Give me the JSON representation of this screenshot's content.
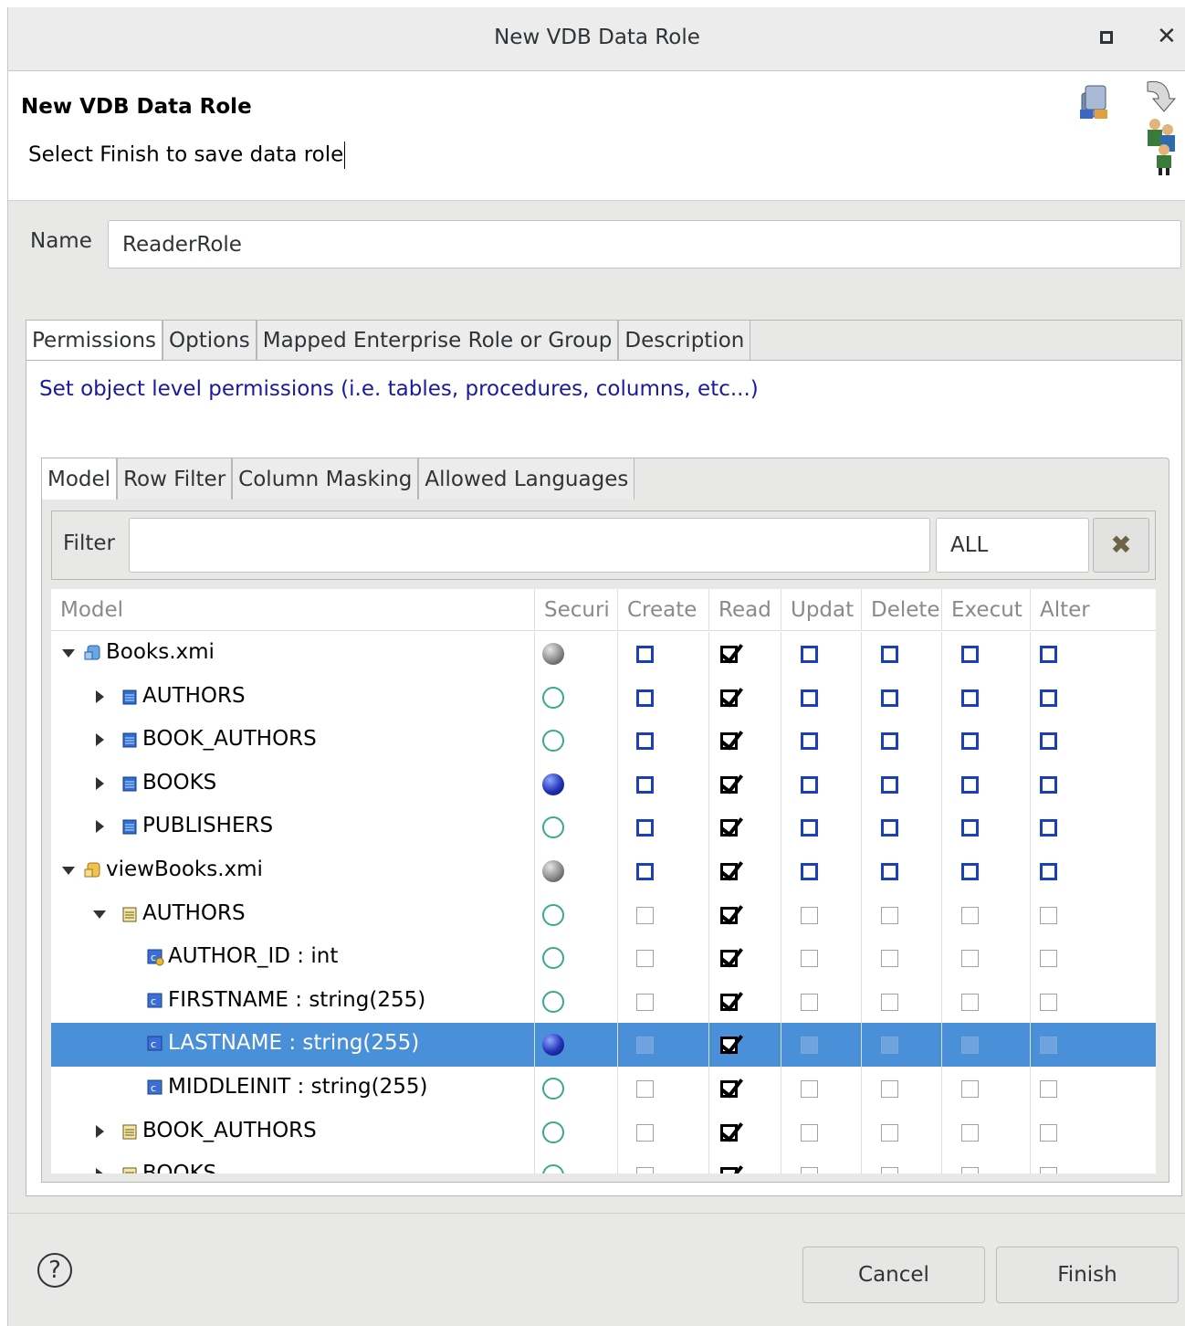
{
  "window": {
    "title": "New VDB Data Role"
  },
  "header": {
    "title": "New VDB Data Role",
    "message": "Select Finish to save data role"
  },
  "name_field": {
    "label": "Name",
    "value": "ReaderRole"
  },
  "outer_tabs": [
    "Permissions",
    "Options",
    "Mapped Enterprise Role or Group",
    "Description"
  ],
  "permissions_description": "Set object level permissions (i.e. tables, procedures, columns, etc...)",
  "inner_tabs": [
    "Model",
    "Row Filter",
    "Column Masking",
    "Allowed Languages"
  ],
  "filter": {
    "label": "Filter",
    "value": "",
    "combo_value": "ALL"
  },
  "table": {
    "columns": [
      "Model",
      "Securi",
      "Create",
      "Read",
      "Updat",
      "Delete",
      "Execut",
      "Alter"
    ],
    "rows": [
      {
        "label": "Books.xmi",
        "icon": "source-model-icon",
        "arrow": "expanded",
        "security": "gray",
        "boxes": "blue",
        "read": true,
        "selected": false
      },
      {
        "label": "AUTHORS",
        "icon": "table-icon",
        "arrow": "collapsed",
        "security": "empty",
        "boxes": "blue",
        "read": true,
        "selected": false
      },
      {
        "label": "BOOK_AUTHORS",
        "icon": "table-icon",
        "arrow": "collapsed",
        "security": "empty",
        "boxes": "blue",
        "read": true,
        "selected": false
      },
      {
        "label": "BOOKS",
        "icon": "table-icon",
        "arrow": "collapsed",
        "security": "blue",
        "boxes": "blue",
        "read": true,
        "selected": false
      },
      {
        "label": "PUBLISHERS",
        "icon": "table-icon",
        "arrow": "collapsed",
        "security": "empty",
        "boxes": "blue",
        "read": true,
        "selected": false
      },
      {
        "label": "viewBooks.xmi",
        "icon": "view-model-icon",
        "arrow": "expanded",
        "security": "gray",
        "boxes": "blue",
        "read": true,
        "selected": false
      },
      {
        "label": "AUTHORS",
        "icon": "view-table-icon",
        "arrow": "expanded",
        "security": "empty",
        "boxes": "gray",
        "read": true,
        "selected": false
      },
      {
        "label": "AUTHOR_ID : int",
        "icon": "key-column-icon",
        "arrow": "none",
        "security": "empty",
        "boxes": "gray",
        "read": true,
        "selected": false
      },
      {
        "label": "FIRSTNAME : string(255)",
        "icon": "column-icon",
        "arrow": "none",
        "security": "empty",
        "boxes": "gray",
        "read": true,
        "selected": false
      },
      {
        "label": "LASTNAME : string(255)",
        "icon": "column-icon",
        "arrow": "none",
        "security": "blue",
        "boxes": "gray",
        "read": true,
        "selected": true
      },
      {
        "label": "MIDDLEINIT : string(255)",
        "icon": "column-icon",
        "arrow": "none",
        "security": "empty",
        "boxes": "gray",
        "read": true,
        "selected": false
      },
      {
        "label": "BOOK_AUTHORS",
        "icon": "view-table-icon",
        "arrow": "collapsed",
        "security": "empty",
        "boxes": "gray",
        "read": true,
        "selected": false
      },
      {
        "label": "BOOKS",
        "icon": "view-table-icon",
        "arrow": "collapsed",
        "security": "empty",
        "boxes": "gray",
        "read": true,
        "selected": false
      }
    ]
  },
  "buttons": {
    "help": "?",
    "cancel": "Cancel",
    "finish": "Finish"
  },
  "colors": {
    "selection": "#4a90d9",
    "checkbox_blue": "#1a3fb8",
    "description_text": "#1a1aa0"
  }
}
